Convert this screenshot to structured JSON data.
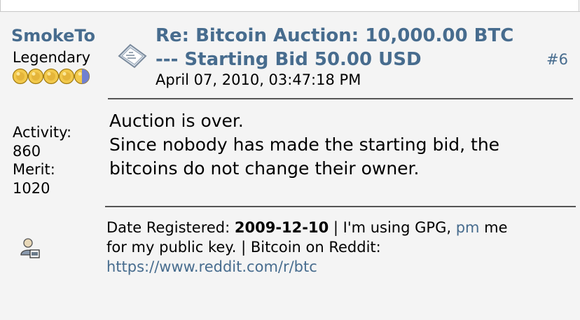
{
  "colors": {
    "link": "#476c8e",
    "background": "#f4f4f4",
    "divider": "#555555",
    "star_gold": "#f2c94c",
    "star_blue": "#7080d0"
  },
  "poster": {
    "name": "SmokeTo",
    "rank": "Legendary",
    "rank_stars": 4.5,
    "activity_label": "Activity:",
    "activity_value": "860",
    "merit_label": "Merit:",
    "merit_value": "1020",
    "post_icon": "post-message-icon",
    "profile_icon": "user-profile-icon"
  },
  "post": {
    "subject_line1": "Re: Bitcoin Auction: 10,000.00 BTC",
    "subject_line2": "--- Starting Bid 50.00 USD",
    "number": "#6",
    "date": "April 07, 2010, 03:47:18 PM",
    "body_lines": [
      "Auction is over.",
      "Since nobody has made the starting bid, the",
      "bitcoins do not change their owner."
    ]
  },
  "signature": {
    "date_label": "Date Registered: ",
    "date_value": "2009-12-10",
    "text_a": " | I'm using GPG, ",
    "pm_link": "pm",
    "text_b": " me",
    "line2": "for my public key. | Bitcoin on Reddit:",
    "reddit_link": "https://www.reddit.com/r/btc"
  }
}
